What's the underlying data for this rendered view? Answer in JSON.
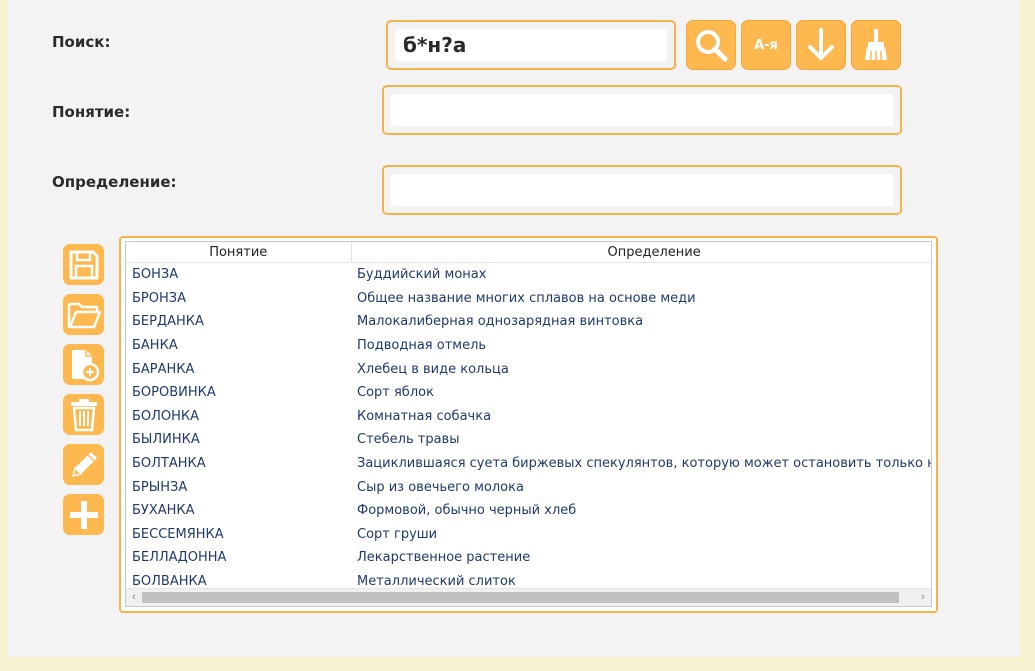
{
  "labels": {
    "search": "Поиск:",
    "concept": "Понятие:",
    "definition": "Определение:"
  },
  "search": {
    "value": "б*н?а"
  },
  "concept": {
    "value": ""
  },
  "definition": {
    "value": ""
  },
  "toolbar": {
    "sort_label": "А-я",
    "icons": [
      "search-icon",
      "sort-alpha-icon",
      "arrow-down-icon",
      "broom-icon"
    ]
  },
  "side_icons": [
    "save-icon",
    "open-folder-icon",
    "new-file-icon",
    "trash-icon",
    "pencil-icon",
    "plus-icon"
  ],
  "grid": {
    "columns": [
      "Понятие",
      "Определение"
    ],
    "rows": [
      {
        "term": "БОНЗА",
        "def": "Буддийский монах"
      },
      {
        "term": "БРОНЗА",
        "def": "Общее название многих сплавов на основе меди"
      },
      {
        "term": "БЕРДАНКА",
        "def": "Малокалиберная однозарядная винтовка"
      },
      {
        "term": "БАНКА",
        "def": "Подводная отмель"
      },
      {
        "term": "БАРАНКА",
        "def": "Хлебец в виде кольца"
      },
      {
        "term": "БОРОВИНКА",
        "def": "Сорт яблок"
      },
      {
        "term": "БОЛОНКА",
        "def": "Комнатная собачка"
      },
      {
        "term": "БЫЛИНКА",
        "def": "Стебель травы"
      },
      {
        "term": "БОЛТАНКА",
        "def": "Зациклившаяся суета биржевых спекулянтов, которую может остановить только наступле"
      },
      {
        "term": "БРЫНЗА",
        "def": "Сыр из овечьего молока"
      },
      {
        "term": "БУХАНКА",
        "def": "Формовой, обычно черный хлеб"
      },
      {
        "term": "БЕССЕМЯНКА",
        "def": "Сорт груши"
      },
      {
        "term": "БЕЛЛАДОННА",
        "def": "Лекарственное растение"
      },
      {
        "term": "БОЛВАНКА",
        "def": "Металлический слиток"
      }
    ]
  },
  "colors": {
    "accent": "#fdb84f",
    "border": "#f8b24a",
    "text_link": "#1f3a6a"
  }
}
